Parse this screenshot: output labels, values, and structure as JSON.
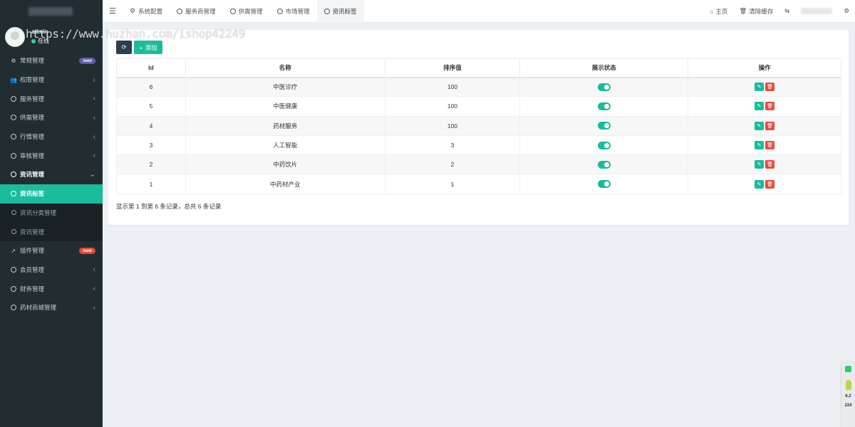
{
  "sidebar": {
    "user": {
      "name": "admin",
      "status": "在线"
    },
    "items": [
      {
        "label": "常规管理",
        "icon": "cogs-icon",
        "badge": "new"
      },
      {
        "label": "权限管理",
        "icon": "group-icon"
      },
      {
        "label": "服务管理",
        "icon": "circle-icon"
      },
      {
        "label": "供需管理",
        "icon": "circle-icon"
      },
      {
        "label": "行情管理",
        "icon": "circle-icon"
      },
      {
        "label": "审核管理",
        "icon": "circle-icon"
      },
      {
        "label": "资讯管理",
        "icon": "circle-icon"
      },
      {
        "label": "资讯标签",
        "icon": "circle-icon"
      },
      {
        "label": "资讯分类管理",
        "icon": "circle-icon"
      },
      {
        "label": "资讯管理",
        "icon": "circle-icon"
      },
      {
        "label": "插件管理",
        "icon": "rocket-icon",
        "badge": "new"
      },
      {
        "label": "会员管理",
        "icon": "circle-icon"
      },
      {
        "label": "财务管理",
        "icon": "circle-icon"
      },
      {
        "label": "药材商城管理",
        "icon": "circle-icon"
      }
    ]
  },
  "topbar": {
    "tabs": [
      {
        "label": "系统配置",
        "icon": "gear-icon"
      },
      {
        "label": "服务商管理",
        "icon": "circle-icon"
      },
      {
        "label": "供需管理",
        "icon": "circle-icon"
      },
      {
        "label": "市场管理",
        "icon": "circle-icon"
      },
      {
        "label": "资讯标签",
        "icon": "circle-icon"
      }
    ],
    "home": "主页",
    "clear_cache": "清除缓存"
  },
  "toolbar": {
    "add_label": "添加"
  },
  "table": {
    "columns": [
      "Id",
      "名称",
      "排序值",
      "展示状态",
      "操作"
    ],
    "rows": [
      {
        "id": "6",
        "name": "中医诊疗",
        "weigh": "100",
        "status": true
      },
      {
        "id": "5",
        "name": "中医健康",
        "weigh": "100",
        "status": true
      },
      {
        "id": "4",
        "name": "药材服务",
        "weigh": "100",
        "status": true
      },
      {
        "id": "3",
        "name": "人工智能",
        "weigh": "3",
        "status": true
      },
      {
        "id": "2",
        "name": "中药饮片",
        "weigh": "2",
        "status": true
      },
      {
        "id": "1",
        "name": "中药材产业",
        "weigh": "1",
        "status": true
      }
    ]
  },
  "pager": {
    "info": "显示第 1 到第 6 条记录，总共 6 条记录"
  },
  "watermark": "https://www.huzhan.com/ishop42249",
  "float_widget": {
    "line1": "6.2",
    "line2": "224"
  },
  "colors": {
    "accent": "#1abc9c",
    "sidebar_bg": "#222d32",
    "danger": "#e74c3c",
    "dark_btn": "#2c3e50"
  }
}
